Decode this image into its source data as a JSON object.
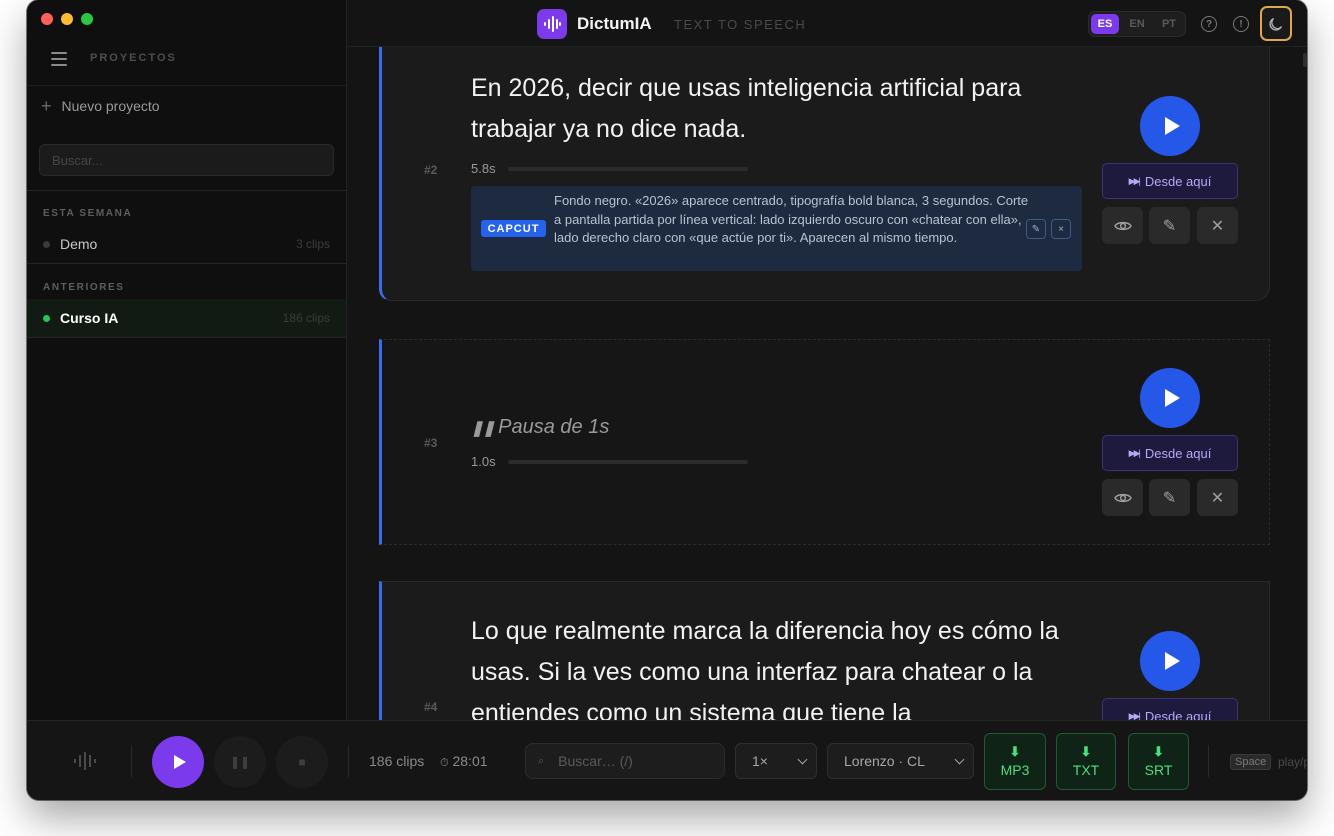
{
  "app": {
    "name": "DictumIA",
    "subtitle": "TEXT TO SPEECH"
  },
  "languages": [
    {
      "code": "ES",
      "active": true
    },
    {
      "code": "EN",
      "active": false
    },
    {
      "code": "PT",
      "active": false
    }
  ],
  "sidebar": {
    "title": "PROYECTOS",
    "new_project": "Nuevo proyecto",
    "search_placeholder": "Buscar...",
    "sections": [
      {
        "label": "ESTA SEMANA",
        "projects": [
          {
            "name": "Demo",
            "count": "3 clips",
            "dot_color": "#3a3a3a",
            "active": false
          }
        ]
      },
      {
        "label": "ANTERIORES",
        "projects": [
          {
            "name": "Curso IA",
            "count": "186 clips",
            "dot_color": "#22c55e",
            "active": true
          }
        ]
      }
    ]
  },
  "clips": [
    {
      "num": "#2",
      "text": "En 2026, decir que usas inteligencia artificial para trabajar ya no dice nada.",
      "duration": "5.8s",
      "note_tag": "CAPCUT",
      "note_text": "Fondo negro. «2026» aparece centrado, tipografía bold blanca, 3 segundos. Corte a pantalla partida por línea vertical: lado izquierdo oscuro con «chatear con ella», lado derecho claro con «que actúe por ti». Aparecen al mismo tiempo.",
      "desde_label": "Desde aquí"
    },
    {
      "num": "#3",
      "pause_label": "Pausa de 1s",
      "duration": "1.0s",
      "desde_label": "Desde aquí"
    },
    {
      "num": "#4",
      "text": "Lo que realmente marca la diferencia hoy es cómo la usas. Si la ves como una interfaz para chatear o la entiendes como un sistema que tiene la",
      "desde_label": "Desde aquí"
    }
  ],
  "bottom": {
    "clip_count": "186 clips",
    "total_time": "28:01",
    "search_placeholder": "Buscar… (/)",
    "speed": "1×",
    "voice": "Lorenzo · CL",
    "exports": [
      "MP3",
      "TXT",
      "SRT"
    ],
    "shortcut_key": "Space",
    "shortcut_label": "play/pause"
  },
  "colors": {
    "accent_purple": "#7c3aed",
    "play_blue": "#2557e8",
    "clip_border": "#3b6cf0",
    "export_green": "#4ade80"
  }
}
